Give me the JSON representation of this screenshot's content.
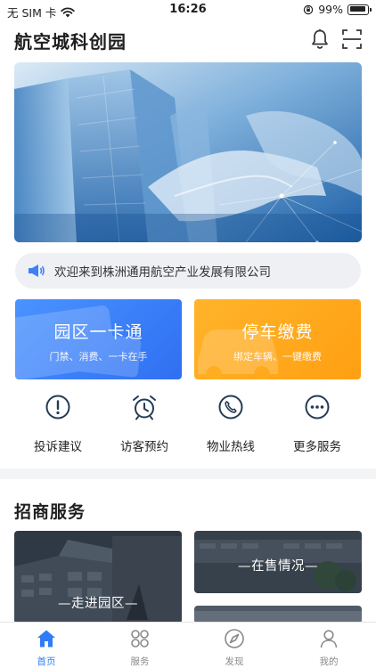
{
  "status_bar": {
    "carrier": "无 SIM 卡",
    "time": "16:26",
    "battery": "99%",
    "battery_level": 0.99
  },
  "header": {
    "title": "航空城科创园"
  },
  "notice": {
    "text": "欢迎来到株洲通用航空产业发展有限公司"
  },
  "cards": [
    {
      "title": "园区一卡通",
      "subtitle": "门禁、消费、一卡在手"
    },
    {
      "title": "停车缴费",
      "subtitle": "绑定车辆、一键缴费"
    }
  ],
  "quick_actions": [
    {
      "label": "投诉建议",
      "icon": "exclamation-circle-icon"
    },
    {
      "label": "访客预约",
      "icon": "alarm-clock-icon"
    },
    {
      "label": "物业热线",
      "icon": "phone-icon"
    },
    {
      "label": "更多服务",
      "icon": "more-dots-icon"
    }
  ],
  "invest": {
    "title": "招商服务",
    "tiles": [
      {
        "label": "—走进园区—"
      },
      {
        "label": "—在售情况—"
      }
    ]
  },
  "tabbar": {
    "active_color": "#2f7cf6",
    "items": [
      {
        "label": "首页",
        "icon": "home-icon"
      },
      {
        "label": "服务",
        "icon": "grid-icon"
      },
      {
        "label": "发现",
        "icon": "compass-icon"
      },
      {
        "label": "我的",
        "icon": "user-icon"
      }
    ]
  }
}
